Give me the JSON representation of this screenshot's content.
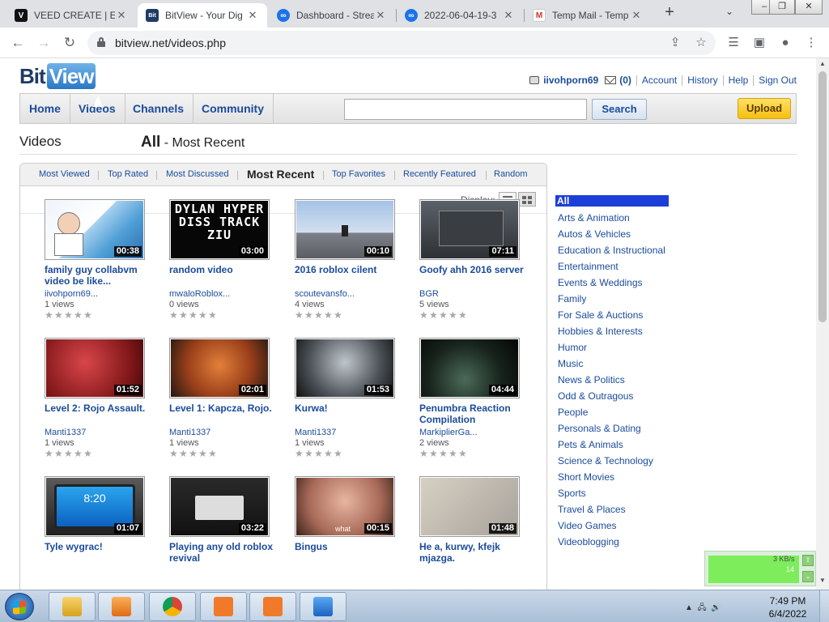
{
  "browser": {
    "tabs": [
      {
        "title": "VEED CREATE | Ed",
        "icon": "V",
        "color": "#111111"
      },
      {
        "title": "BitView - Your Dig",
        "icon": "Bit",
        "color": "#1f3a66"
      },
      {
        "title": "Dashboard - Strea",
        "icon": "∞",
        "color": "#1a73e8"
      },
      {
        "title": "2022-06-04-19-3",
        "icon": "∞",
        "color": "#1a73e8"
      },
      {
        "title": "Temp Mail - Temp",
        "icon": "M",
        "color": "#d93025"
      }
    ],
    "url": "bitview.net/videos.php"
  },
  "site": {
    "logo_bit": "Bit",
    "logo_view": "View",
    "user": {
      "username": "iivohporn69",
      "inbox_count": "(0)",
      "links": [
        "Account",
        "History",
        "Help",
        "Sign Out"
      ]
    },
    "nav": [
      "Home",
      "Videos",
      "Channels",
      "Community"
    ],
    "search": {
      "value": "",
      "button": "Search"
    },
    "upload": "Upload"
  },
  "page": {
    "heading": "Videos",
    "filter_label": "All",
    "filter_sub": "- Most Recent",
    "sort_tabs": [
      "Most Viewed",
      "Top Rated",
      "Most Discussed",
      "Most Recent",
      "Top Favorites",
      "Recently Featured",
      "Random"
    ],
    "current_sort": "Most Recent",
    "display_label": "Display:"
  },
  "videos": [
    {
      "title": "family guy collabvm video be like...",
      "duration": "00:38",
      "author": "iivohporn69...",
      "views": "1 views",
      "rating": 0
    },
    {
      "title": "random video",
      "duration": "03:00",
      "author": "mwaloRoblox...",
      "views": "0 views",
      "rating": 0
    },
    {
      "title": "2016 roblox cilent",
      "duration": "00:10",
      "author": "scoutevansfo...",
      "views": "4 views",
      "rating": 0
    },
    {
      "title": "Goofy ahh 2016 server",
      "duration": "07:11",
      "author": "BGR",
      "views": "5 views",
      "rating": 0
    },
    {
      "title": "Level 2: Rojo Assault.",
      "duration": "01:52",
      "author": "Manti1337",
      "views": "1 views",
      "rating": 0
    },
    {
      "title": "Level 1: Kapcza, Rojo.",
      "duration": "02:01",
      "author": "Manti1337",
      "views": "1 views",
      "rating": 0
    },
    {
      "title": "Kurwa!",
      "duration": "01:53",
      "author": "Manti1337",
      "views": "1 views",
      "rating": 0
    },
    {
      "title": "Penumbra Reaction Compilation",
      "duration": "04:44",
      "author": "MarkiplierGa...",
      "views": "2 views",
      "rating": 0
    },
    {
      "title": "Tyle wygrac!",
      "duration": "01:07",
      "author": "",
      "views": "",
      "rating": 0
    },
    {
      "title": "Playing any old roblox revival",
      "duration": "03:22",
      "author": "",
      "views": "",
      "rating": 0
    },
    {
      "title": "Bingus",
      "duration": "00:15",
      "author": "",
      "views": "",
      "rating": 0
    },
    {
      "title": "He a, kurwy, kfejk mjazga.",
      "duration": "01:48",
      "author": "",
      "views": "",
      "rating": 0
    }
  ],
  "thumb_texts": {
    "t2": "DYLAN HYPER DISS TRACK ZIU",
    "t11": "what",
    "t9": "8:20"
  },
  "categories": [
    "All",
    "Arts & Animation",
    "Autos & Vehicles",
    "Education & Instructional",
    "Entertainment",
    "Events & Weddings",
    "Family",
    "For Sale & Auctions",
    "Hobbies & Interests",
    "Humor",
    "Music",
    "News & Politics",
    "Odd & Outragous",
    "People",
    "Personals & Dating",
    "Pets & Animals",
    "Science & Technology",
    "Short Movies",
    "Sports",
    "Travel & Places",
    "Video Games",
    "Videoblogging"
  ],
  "selected_category": "All",
  "net_widget": {
    "rate": "3 KB/s",
    "value": "14"
  },
  "taskbar": {
    "time": "7:49 PM",
    "date": "6/4/2022"
  },
  "colors": {
    "link": "#1a4b9b",
    "selected_category": "#1c3fd8",
    "upload": "#f5bf0f"
  }
}
